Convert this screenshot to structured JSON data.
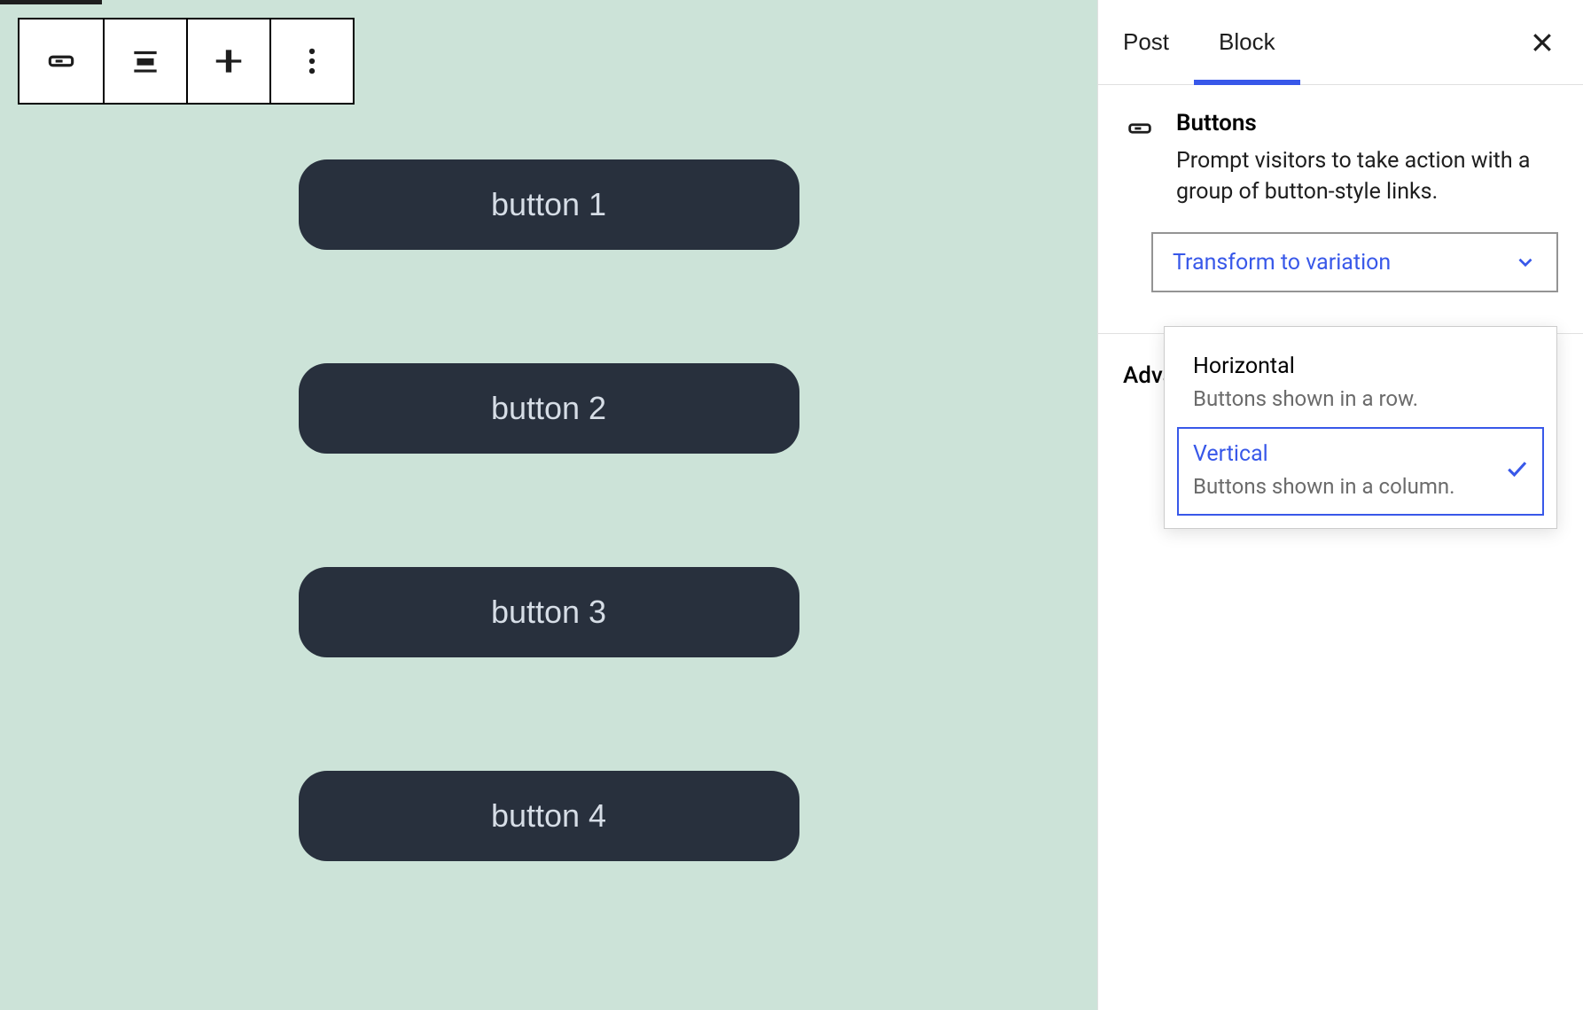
{
  "toolbar": {
    "icons": [
      "buttons-block-icon",
      "align-icon",
      "vertical-align-icon",
      "more-options-icon"
    ]
  },
  "canvas": {
    "buttons": [
      "button 1",
      "button 2",
      "button 3",
      "button 4"
    ]
  },
  "sidebar": {
    "tabs": {
      "post": "Post",
      "block": "Block",
      "active": "block"
    },
    "block": {
      "title": "Buttons",
      "description": "Prompt visitors to take action with a group of button-style links."
    },
    "transform": {
      "label": "Transform to variation",
      "options": [
        {
          "title": "Horizontal",
          "description": "Buttons shown in a row.",
          "selected": false
        },
        {
          "title": "Vertical",
          "description": "Buttons shown in a column.",
          "selected": true
        }
      ]
    },
    "advanced_label": "Advanced"
  },
  "colors": {
    "accent": "#3858e9",
    "button_bg": "#28303d",
    "canvas_bg": "#cce3d8"
  }
}
